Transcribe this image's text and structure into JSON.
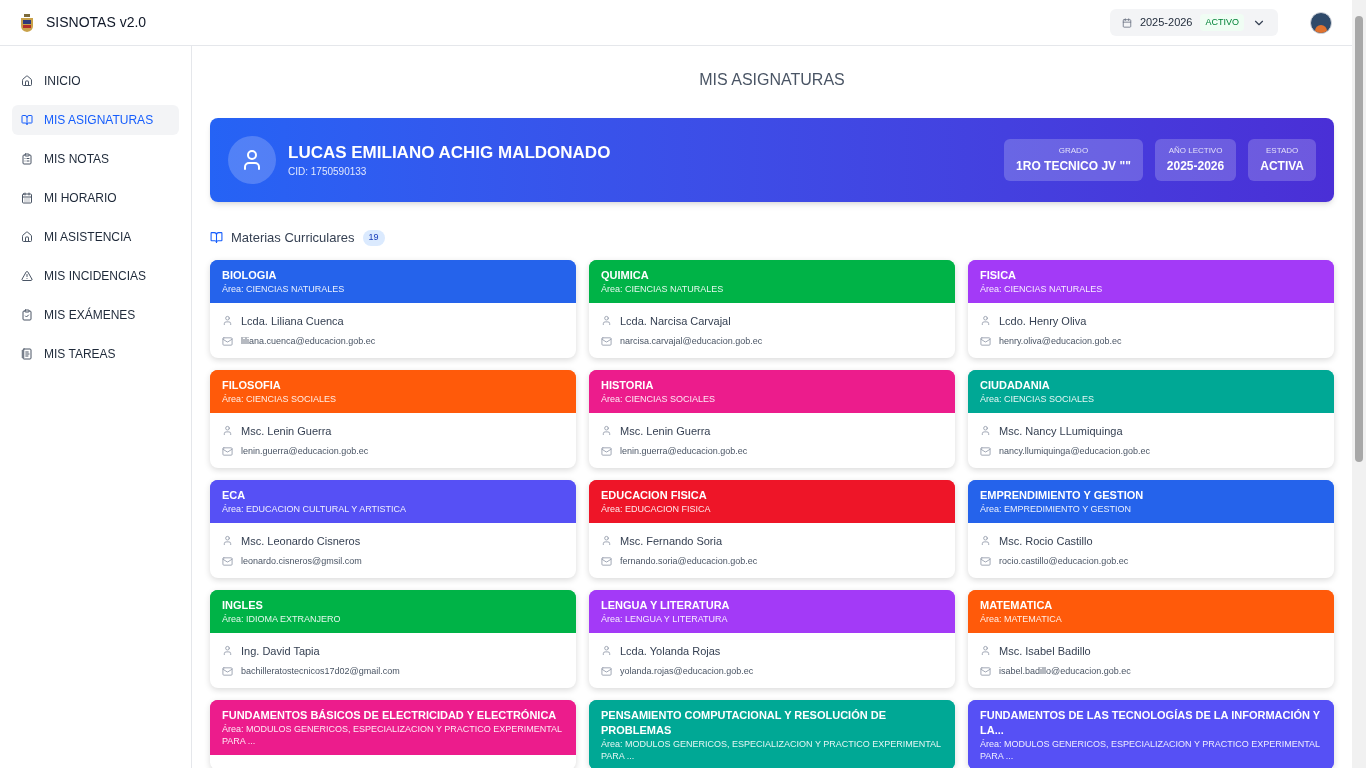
{
  "app": {
    "title": "SISNOTAS v2.0"
  },
  "period_selector": {
    "year": "2025-2026",
    "badge": "ACTIVO"
  },
  "sidebar": {
    "items": [
      {
        "label": "INICIO",
        "selected": false
      },
      {
        "label": "MIS ASIGNATURAS",
        "selected": true
      },
      {
        "label": "MIS NOTAS",
        "selected": false
      },
      {
        "label": "MI HORARIO",
        "selected": false
      },
      {
        "label": "MI ASISTENCIA",
        "selected": false
      },
      {
        "label": "MIS INCIDENCIAS",
        "selected": false
      },
      {
        "label": "MIS EXÁMENES",
        "selected": false
      },
      {
        "label": "MIS TAREAS",
        "selected": false
      }
    ]
  },
  "page_title": "MIS ASIGNATURAS",
  "student": {
    "name": "LUCAS EMILIANO ACHIG MALDONADO",
    "cid": "CID: 1750590133",
    "stats": [
      {
        "label": "GRADO",
        "value": "1RO TECNICO JV \"\""
      },
      {
        "label": "AÑO LECTIVO",
        "value": "2025-2026"
      },
      {
        "label": "ESTADO",
        "value": "ACTIVA"
      }
    ]
  },
  "section": {
    "title": "Materias Curriculares",
    "count": "19"
  },
  "subjects": [
    {
      "title": "BIOLOGIA",
      "area": "Área: CIENCIAS NATURALES",
      "color": "#2563eb",
      "teacher": "Lcda. Liliana Cuenca",
      "email": "liliana.cuenca@educacion.gob.ec"
    },
    {
      "title": "QUIMICA",
      "area": "Área: CIENCIAS NATURALES",
      "color": "#00b347",
      "teacher": "Lcda. Narcisa Carvajal",
      "email": "narcisa.carvajal@educacion.gob.ec"
    },
    {
      "title": "FISICA",
      "area": "Área: CIENCIAS NATURALES",
      "color": "#a33af7",
      "teacher": "Lcdo. Henry Oliva",
      "email": "henry.oliva@educacion.gob.ec"
    },
    {
      "title": "FILOSOFIA",
      "area": "Área: CIENCIAS SOCIALES",
      "color": "#ff5a0a",
      "teacher": "Msc. Lenin Guerra",
      "email": "lenin.guerra@educacion.gob.ec"
    },
    {
      "title": "HISTORIA",
      "area": "Área: CIENCIAS SOCIALES",
      "color": "#ec1c8c",
      "teacher": "Msc. Lenin Guerra",
      "email": "lenin.guerra@educacion.gob.ec"
    },
    {
      "title": "CIUDADANIA",
      "area": "Área: CIENCIAS SOCIALES",
      "color": "#00a895",
      "teacher": "Msc. Nancy LLumiquinga",
      "email": "nancy.llumiquinga@educacion.gob.ec"
    },
    {
      "title": "ECA",
      "area": "Área: EDUCACION CULTURAL Y ARTISTICA",
      "color": "#5650f5",
      "teacher": "Msc. Leonardo Cisneros",
      "email": "leonardo.cisneros@gmsil.com"
    },
    {
      "title": "EDUCACION FISICA",
      "area": "Área: EDUCACION FISICA",
      "color": "#ee1528",
      "teacher": "Msc. Fernando Soria",
      "email": "fernando.soria@educacion.gob.ec"
    },
    {
      "title": "EMPRENDIMIENTO Y GESTION",
      "area": "Área: EMPREDIMIENTO Y GESTION",
      "color": "#2563eb",
      "teacher": "Msc. Rocio Castillo",
      "email": "rocio.castillo@educacion.gob.ec"
    },
    {
      "title": "INGLES",
      "area": "Área: IDIOMA EXTRANJERO",
      "color": "#00b347",
      "teacher": "Ing. David Tapia",
      "email": "bachilleratostecnicos17d02@gmail.com"
    },
    {
      "title": "LENGUA Y LITERATURA",
      "area": "Área: LENGUA Y LITERATURA",
      "color": "#a33af7",
      "teacher": "Lcda. Yolanda Rojas",
      "email": "yolanda.rojas@educacion.gob.ec"
    },
    {
      "title": "MATEMATICA",
      "area": "Área: MATEMATICA",
      "color": "#ff5a0a",
      "teacher": "Msc. Isabel Badillo",
      "email": "isabel.badillo@educacion.gob.ec"
    },
    {
      "title": "FUNDAMENTOS BÁSICOS DE ELECTRICIDAD Y ELECTRÓNICA",
      "area": "Área: MODULOS GENERICOS, ESPECIALIZACION Y PRACTICO EXPERIMENTAL PARA ...",
      "color": "#ec1c8c"
    },
    {
      "title": "PENSAMIENTO COMPUTACIONAL Y RESOLUCIÓN DE PROBLEMAS",
      "area": "Área: MODULOS GENERICOS, ESPECIALIZACION Y PRACTICO EXPERIMENTAL PARA ...",
      "color": "#00a895"
    },
    {
      "title": "FUNDAMENTOS DE LAS TECNOLOGÍAS DE LA INFORMACIÓN Y LA...",
      "area": "Área: MODULOS GENERICOS, ESPECIALIZACION Y PRACTICO EXPERIMENTAL PARA ...",
      "color": "#5650f5"
    }
  ]
}
